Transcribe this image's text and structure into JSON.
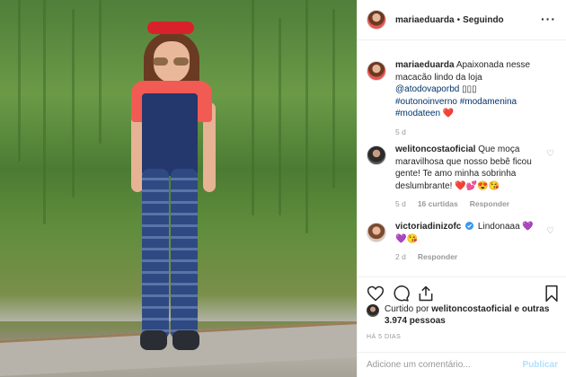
{
  "post": {
    "author": "mariaeduarda",
    "separator": "•",
    "follow_status": "Seguindo",
    "more_icon": "ellipsis-icon"
  },
  "caption": {
    "username": "mariaeduarda",
    "text": "Apaixonada nesse macacão lindo da loja",
    "mention": "@atodovaporbd",
    "mention_suffix": "▯▯▯",
    "hashtags": "#outonoinverno #modamenina #modateen",
    "emoji": "❤️",
    "age": "5 d"
  },
  "comments": [
    {
      "username": "welitoncostaoficial",
      "text": "Que moça maravilhosa que nosso bebê ficou gente! Te amo minha sobrinha deslumbrante!",
      "emoji": "❤️💕😍😘",
      "age": "5 d",
      "likes": "16 curtidas",
      "reply": "Responder"
    },
    {
      "username": "victoriadinizofc",
      "verified_icon": "verified-badge-icon",
      "text": "Lindonaaa",
      "emoji": "💜💜😘",
      "age": "2 d",
      "reply": "Responder"
    }
  ],
  "actions": {
    "like_icon": "heart-icon",
    "comment_icon": "comment-icon",
    "share_icon": "share-icon",
    "save_icon": "bookmark-icon"
  },
  "likes": {
    "prefix": "Curtido por",
    "username": "welitoncostaoficial",
    "suffix": "e outras 3.974 pessoas"
  },
  "timestamp": "HÁ 5 DIAS",
  "comment_box": {
    "placeholder": "Adicione um comentário...",
    "post_label": "Publicar"
  },
  "colors": {
    "link": "#003569",
    "muted": "#999999",
    "post_button_disabled": "#b2dffc",
    "heart_red": "#ed4956"
  }
}
